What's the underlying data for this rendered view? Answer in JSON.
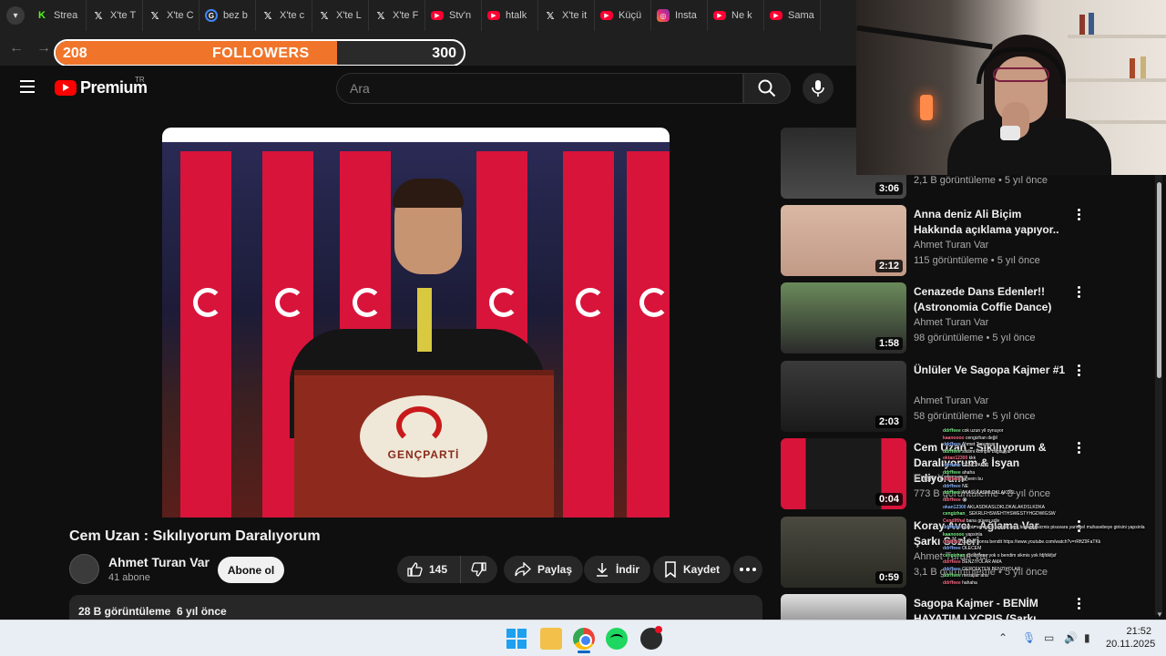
{
  "browser": {
    "tabs": [
      {
        "icon": "kick-icon",
        "glyph": "K",
        "label": "Strea"
      },
      {
        "icon": "x-icon",
        "glyph": "𝕏",
        "label": "X'te T"
      },
      {
        "icon": "x-icon",
        "glyph": "𝕏",
        "label": "X'te C"
      },
      {
        "icon": "google-icon",
        "glyph": "G",
        "label": "bez b"
      },
      {
        "icon": "x-icon",
        "glyph": "𝕏",
        "label": "X'te c"
      },
      {
        "icon": "x-icon",
        "glyph": "𝕏",
        "label": "X'te L"
      },
      {
        "icon": "x-icon",
        "glyph": "𝕏",
        "label": "X'te F"
      },
      {
        "icon": "youtube-icon",
        "glyph": "▶",
        "label": "Stv'n"
      },
      {
        "icon": "youtube-icon",
        "glyph": "▶",
        "label": "htalk"
      },
      {
        "icon": "x-icon",
        "glyph": "𝕏",
        "label": "X'te it"
      },
      {
        "icon": "youtube-icon",
        "glyph": "▶",
        "label": "Küçü"
      },
      {
        "icon": "instagram-icon",
        "glyph": "◎",
        "label": "Insta"
      },
      {
        "icon": "youtube-icon",
        "glyph": "▶",
        "label": "Ne k"
      },
      {
        "icon": "youtube-icon",
        "glyph": "▶",
        "label": "Sama"
      }
    ]
  },
  "followers_goal": {
    "current": "208",
    "label": "FOLLOWERS",
    "goal": "300",
    "progress": 0.69
  },
  "youtube": {
    "logo_text": "Premium",
    "region": "TR",
    "search_placeholder": "Ara",
    "video": {
      "title": "Cem Uzan : Sıkılıyorum Daralıyorum",
      "podium_text": "GENÇPARTİ",
      "channel": "Ahmet Turan Var",
      "subscribers": "41 abone",
      "subscribe_label": "Abone ol",
      "likes": "145",
      "share_label": "Paylaş",
      "download_label": "İndir",
      "save_label": "Kaydet",
      "views": "28 B görüntüleme",
      "age": "6 yıl önce"
    },
    "recommendations": [
      {
        "title": "",
        "channel": "",
        "meta": "2,1 B görüntüleme • 5 yıl önce",
        "duration": "3:06"
      },
      {
        "title": "Anna deniz Ali Biçim Hakkında açıklama yapıyor..",
        "channel": "Ahmet Turan Var",
        "meta": "115 görüntüleme • 5 yıl önce",
        "duration": "2:12"
      },
      {
        "title": "Cenazede Dans Edenler!! (Astronomia Coffie Dance)",
        "channel": "Ahmet Turan Var",
        "meta": "98 görüntüleme • 5 yıl önce",
        "duration": "1:58"
      },
      {
        "title": "Ünlüler Ve Sagopa Kajmer #1",
        "channel": "Ahmet Turan Var",
        "meta": "58 görüntüleme • 5 yıl önce",
        "duration": "2:03"
      },
      {
        "title": "Cem Uzan - Sıkılıyorum & Daralıyorum & İsyan Ediyorum",
        "channel": "Eren Yılmaz",
        "meta": "773 B görüntüleme • 8 yıl önce",
        "duration": "0:04"
      },
      {
        "title": "Koray Avcı - Ağlama Var Şarkı Sözleri",
        "channel": "Ahmet Turan Var",
        "meta": "3,1 B görüntüleme • 5 yıl önce",
        "duration": "0:59"
      },
      {
        "title": "Sagopa Kajmer - BENİM HAYATIM LYCRIS (Şarkı Sözleri)",
        "channel": "",
        "meta": "",
        "duration": ""
      }
    ]
  },
  "chat": [
    {
      "user": "ddrffeee",
      "text": "cok uzun yil oynuyor"
    },
    {
      "user": "kaanoooo",
      "text": "cengizhan değil"
    },
    {
      "user": "ddrffeee",
      "text": "Ahmet Turan var"
    },
    {
      "user": "ddrffeee",
      "text": "sildimi komple bilgisayar"
    },
    {
      "user": "oktan12300",
      "text": "kkk"
    },
    {
      "user": "ddrffeee",
      "text": "GENCPARTİ"
    },
    {
      "user": "ddrffeee",
      "text": "ahaha"
    },
    {
      "user": "ddrffeee",
      "text": "jahvein bu"
    },
    {
      "user": "ddrffeee",
      "text": "NE"
    },
    {
      "user": "ddrffeee",
      "text": "AKASLKASMLDKLAKDSL"
    },
    {
      "user": "ddrffeee",
      "text": "😭"
    },
    {
      "user": "okan12300",
      "text": "AKLASDKASLDKLDKALAKDSLKDKA"
    },
    {
      "user": "cengizhan_",
      "text": "SEKRLFHSWEHTHSWESTYHGDWIGSW"
    },
    {
      "user": "Cendlfthal",
      "text": "bana güven sdiv"
    },
    {
      "user": "ddrffeee",
      "text": "abi biz seni sicti sandik ama baskani sicmis pisuvara yaringel muhasebeye girisini yapsinla"
    },
    {
      "user": "kaanoooo",
      "text": "yapsinla"
    },
    {
      "user": "ddrffeee",
      "text": "bunlan sonra bendit https://www.youtube.com/watch?v=rRftZ9FaTKk"
    },
    {
      "user": "ddrffeee",
      "text": "OLECEM"
    },
    {
      "user": "cengizhan",
      "text": "@ddrffeee yok o bendim sikmis yok fdjfdkfjsf"
    },
    {
      "user": "ddrffeee",
      "text": "BENZİYOLAR AMA"
    },
    {
      "user": "ddrffeee",
      "text": "GERÇEKTEN BENZİYOLAR"
    },
    {
      "user": "ddrffeee",
      "text": "mesajlar aha"
    },
    {
      "user": "ddrffeee",
      "text": "hahaha"
    }
  ],
  "taskbar": {
    "time": "21:52",
    "date": "20.11.2025"
  },
  "colors": {
    "accent": "#f0752a",
    "youtube_red": "#ff0000",
    "background": "#0f0f0f"
  }
}
